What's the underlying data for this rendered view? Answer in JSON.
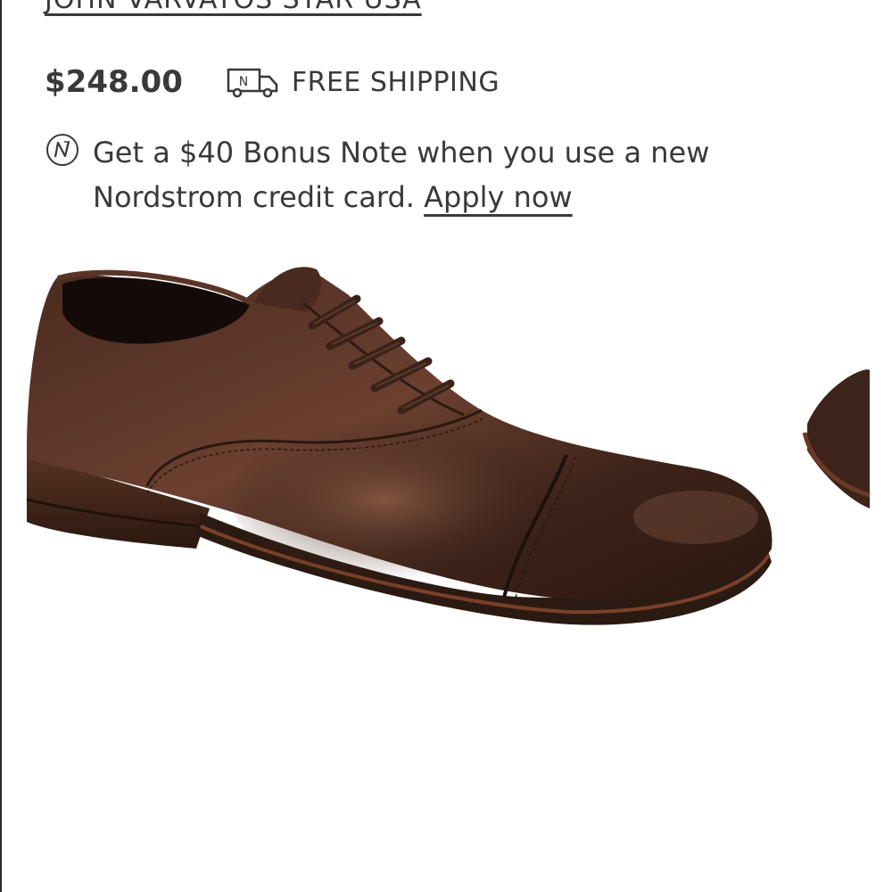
{
  "product": {
    "brand_link": "JOHN VARVATOS STAR USA",
    "price": "$248.00",
    "shipping_label": "FREE SHIPPING",
    "truck_icon_letter": "N"
  },
  "promo": {
    "text_before_link": "Get a $40 Bonus Note when you use a new Nordstrom credit card. ",
    "link_label": "Apply now"
  },
  "image": {
    "alt": "brown leather cap-toe oxford shoe"
  },
  "colors": {
    "text": "#393939",
    "leather_dark": "#3a2219",
    "leather_mid": "#5a3426",
    "sole": "#2b1a12"
  }
}
